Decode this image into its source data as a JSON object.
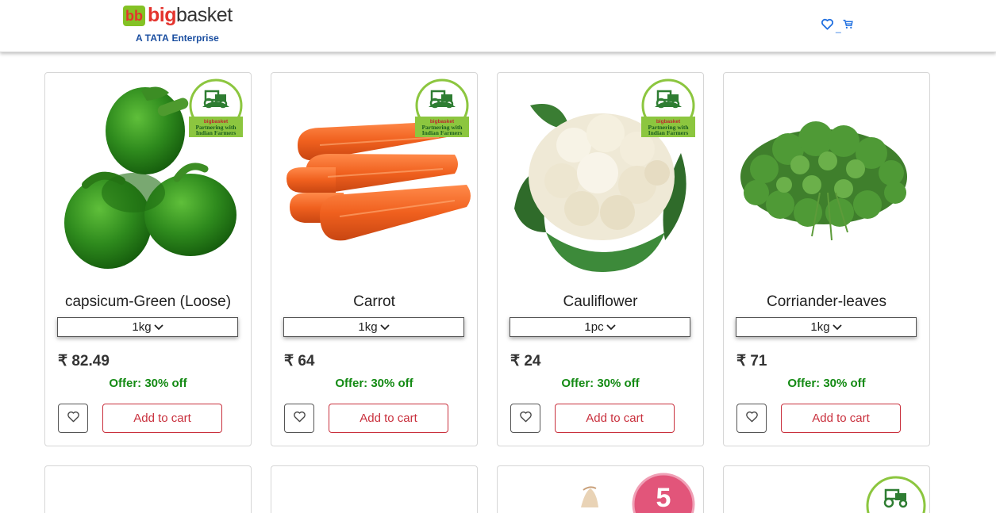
{
  "header": {
    "logo_bb": "bb",
    "logo_big": "big",
    "logo_basket": "basket",
    "tagline_a": "A",
    "tagline_tata": "TATA",
    "tagline_enterprise": "Enterprise",
    "dash": "_",
    "icons": [
      "heart-icon",
      "cart-icon"
    ],
    "accent": "#1f6fe0"
  },
  "badge": {
    "line1": "bigbasket",
    "line2": "Partnering with",
    "line3": "Indian Farmers"
  },
  "products": [
    {
      "name": "capsicum-Green (Loose)",
      "qty": "1kg",
      "price": "₹ 82.49",
      "offer": "Offer: 30% off",
      "add_label": "Add to cart",
      "image": "green-capsicum"
    },
    {
      "name": "Carrot",
      "qty": "1kg",
      "price": "₹ 64",
      "offer": "Offer: 30% off",
      "add_label": "Add to cart",
      "image": "carrot"
    },
    {
      "name": "Cauliflower",
      "qty": "1pc",
      "price": "₹ 24",
      "offer": "Offer: 30% off",
      "add_label": "Add to cart",
      "image": "cauliflower"
    },
    {
      "name": "Corriander-leaves",
      "qty": "1kg",
      "price": "₹ 71",
      "offer": "Offer: 30% off",
      "add_label": "Add to cart",
      "image": "coriander"
    }
  ],
  "second_row": {
    "badge5": "5"
  },
  "colors": {
    "offer": "#138a13",
    "add_to_cart": "#c9303d",
    "brand_green": "#84c225",
    "brand_red": "#e4332d"
  }
}
